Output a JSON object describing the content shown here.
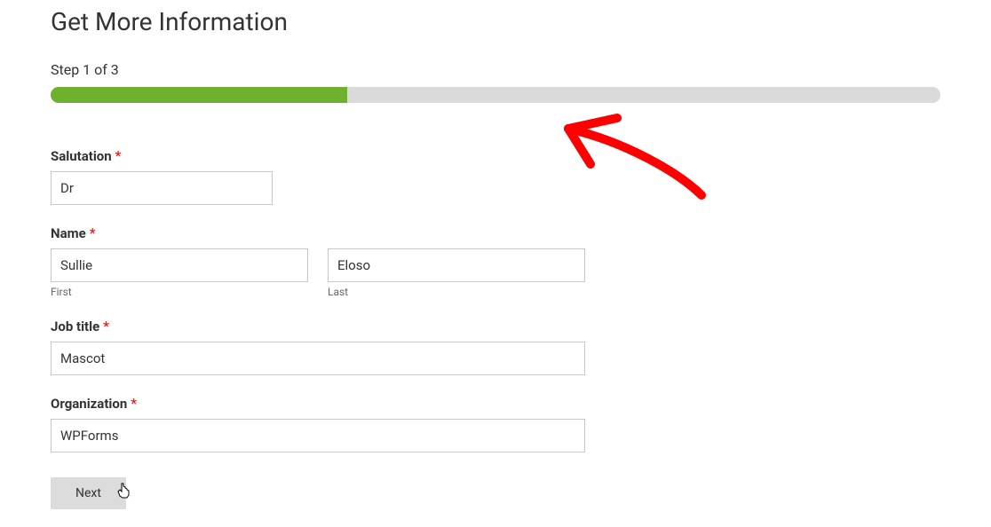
{
  "header": {
    "title": "Get More Information"
  },
  "progress": {
    "step_label": "Step 1 of 3",
    "percent": 33.33
  },
  "fields": {
    "salutation": {
      "label": "Salutation",
      "required_mark": "*",
      "value": "Dr"
    },
    "name": {
      "label": "Name",
      "required_mark": "*",
      "first": {
        "value": "Sullie",
        "sublabel": "First"
      },
      "last": {
        "value": "Eloso",
        "sublabel": "Last"
      }
    },
    "job_title": {
      "label": "Job title",
      "required_mark": "*",
      "value": "Mascot"
    },
    "organization": {
      "label": "Organization",
      "required_mark": "*",
      "value": "WPForms"
    }
  },
  "buttons": {
    "next": "Next"
  },
  "colors": {
    "progress_fill": "#6fb02e",
    "progress_bg": "#dadada",
    "required": "#ff0000"
  }
}
